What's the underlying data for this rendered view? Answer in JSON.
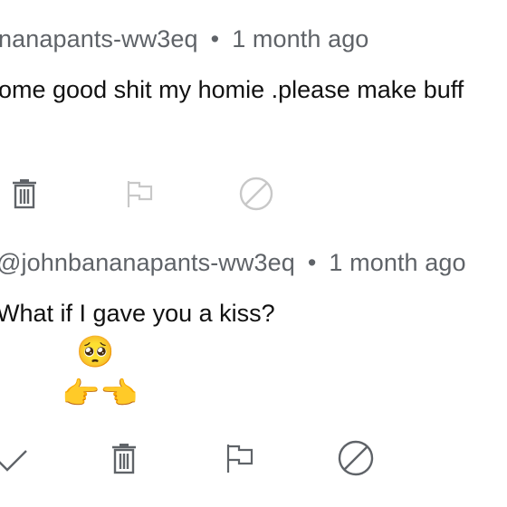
{
  "comments": [
    {
      "author": "nanapants-ww3eq",
      "separator": "•",
      "time": "1 month ago",
      "text": "ome good shit my homie .please make buff",
      "actions": [
        {
          "name": "delete",
          "icon": "trash-icon",
          "enabled": true
        },
        {
          "name": "report",
          "icon": "flag-icon",
          "enabled": false
        },
        {
          "name": "block",
          "icon": "block-icon",
          "enabled": false
        }
      ]
    },
    {
      "author": "@johnbananapants-ww3eq",
      "separator": "•",
      "time": "1 month ago",
      "text": "What if I gave you a kiss?",
      "emoji_line_1": "🥺",
      "emoji_line_2": "👉👈",
      "actions": [
        {
          "name": "approve",
          "icon": "checkmark-icon",
          "enabled": true
        },
        {
          "name": "delete",
          "icon": "trash-icon",
          "enabled": true
        },
        {
          "name": "report",
          "icon": "flag-icon",
          "enabled": true
        },
        {
          "name": "block",
          "icon": "block-icon",
          "enabled": true
        }
      ]
    }
  ],
  "colors": {
    "meta_text": "#5f6368",
    "body_text": "#111111",
    "icon_active": "#5f6368",
    "icon_disabled": "#c8c8c8"
  }
}
